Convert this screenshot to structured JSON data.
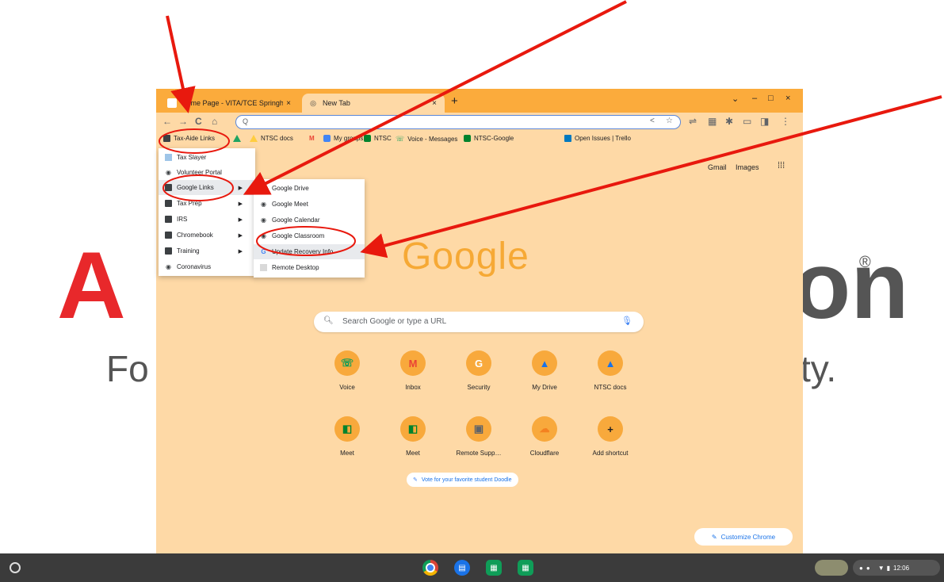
{
  "background": {
    "logo_left": "A",
    "logo_right": "on",
    "registered": "®",
    "tagline_left": "Fo",
    "tagline_right": "ty."
  },
  "tabs": [
    {
      "label": "Home Page - VITA/TCE Springh…",
      "close": "×"
    },
    {
      "label": "New Tab",
      "close": "×"
    }
  ],
  "new_tab_glyph": "+",
  "window_controls": {
    "chevron": "⌄",
    "minimize": "–",
    "maximize": "□",
    "close": "×"
  },
  "toolbar": {
    "back": "←",
    "forward": "→",
    "reload": "C",
    "home": "⌂",
    "search_glyph": "Q",
    "share": "<",
    "star": "☆"
  },
  "bookmarks": [
    {
      "label": "Tax-Aide Links",
      "icon": "folder-icon"
    },
    {
      "label": "",
      "icon": "drive-icon"
    },
    {
      "label": "NTSC docs",
      "icon": "drive-icon"
    },
    {
      "label": "",
      "icon": "gmail-icon"
    },
    {
      "label": "My groups",
      "icon": "groups-icon"
    },
    {
      "label": "NTSC",
      "icon": "meet-icon"
    },
    {
      "label": "Voice - Messages",
      "icon": "voice-icon"
    },
    {
      "label": "NTSC-Google",
      "icon": "meet-icon"
    },
    {
      "label": "Open Issues | Trello",
      "icon": "trello-icon"
    }
  ],
  "ntp": {
    "gmail": "Gmail",
    "images": "Images",
    "logo": "Google",
    "search_placeholder": "Search Google or type a URL",
    "doodle": "Vote for your favorite student Doodle",
    "customize": "Customize Chrome"
  },
  "shortcuts": [
    {
      "label": "Voice",
      "glyph": "☏",
      "color": "#0f9d58"
    },
    {
      "label": "Inbox",
      "glyph": "M",
      "color": "#ea4335"
    },
    {
      "label": "Security",
      "glyph": "G",
      "color": "#ffffff"
    },
    {
      "label": "My Drive",
      "glyph": "▲",
      "color": "#1a73e8"
    },
    {
      "label": "NTSC docs",
      "glyph": "▲",
      "color": "#1a73e8"
    },
    {
      "label": "Meet",
      "glyph": "◧",
      "color": "#00832d"
    },
    {
      "label": "Meet",
      "glyph": "◧",
      "color": "#00832d"
    },
    {
      "label": "Remote Supp…",
      "glyph": "▣",
      "color": "#5f6368"
    },
    {
      "label": "Cloudflare",
      "glyph": "☁",
      "color": "#f48120"
    },
    {
      "label": "Add shortcut",
      "glyph": "+",
      "color": "#202124"
    }
  ],
  "menu_folder": {
    "items": [
      {
        "label": "Tax Slayer",
        "icon": "page"
      },
      {
        "label": "Volunteer Portal",
        "icon": "globe"
      },
      {
        "label": "Google Links",
        "icon": "folder",
        "submenu": true
      },
      {
        "label": "Tax Prep",
        "icon": "folder",
        "submenu": true
      },
      {
        "label": "IRS",
        "icon": "folder",
        "submenu": true
      },
      {
        "label": "Chromebook",
        "icon": "folder",
        "submenu": true
      },
      {
        "label": "Training",
        "icon": "folder",
        "submenu": true
      },
      {
        "label": "Coronavirus",
        "icon": "globe"
      }
    ],
    "arrow": "▶"
  },
  "menu_google": {
    "items": [
      {
        "label": "Google Drive"
      },
      {
        "label": "Google Meet"
      },
      {
        "label": "Google Calendar"
      },
      {
        "label": "Google Classroom"
      },
      {
        "label": "Update Recovery Info"
      },
      {
        "label": "Remote Desktop"
      }
    ]
  },
  "shelf": {
    "time": "12:06",
    "colors": {
      "chrome": "#db4437",
      "files": "#1a73e8",
      "sheets": "#0f9d58"
    }
  },
  "annotation_color": "#e8190e"
}
